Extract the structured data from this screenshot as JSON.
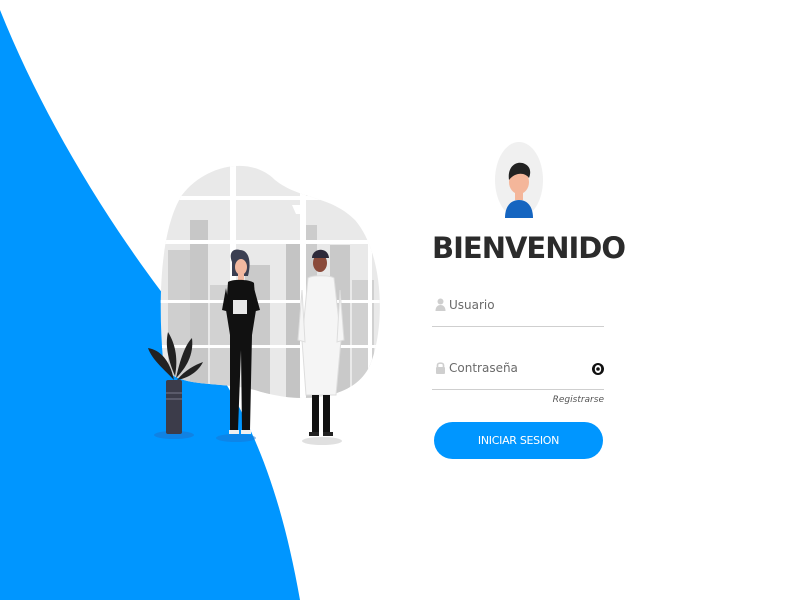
{
  "theme": {
    "accent": "#0096ff",
    "title_color": "#2b2b2b",
    "background": "#ffffff"
  },
  "login": {
    "title": "BIENVENIDO",
    "avatar_icon": "user-avatar-icon",
    "username": {
      "placeholder": "Usuario",
      "value": "",
      "icon": "user-icon"
    },
    "password": {
      "placeholder": "Contraseña",
      "value": "",
      "icon": "lock-icon",
      "toggle_icon": "eye-icon"
    },
    "register_link": "Registrarse",
    "submit_label": "INICIAR SESION"
  },
  "illustration": {
    "description_icon": "doctors-illustration"
  }
}
